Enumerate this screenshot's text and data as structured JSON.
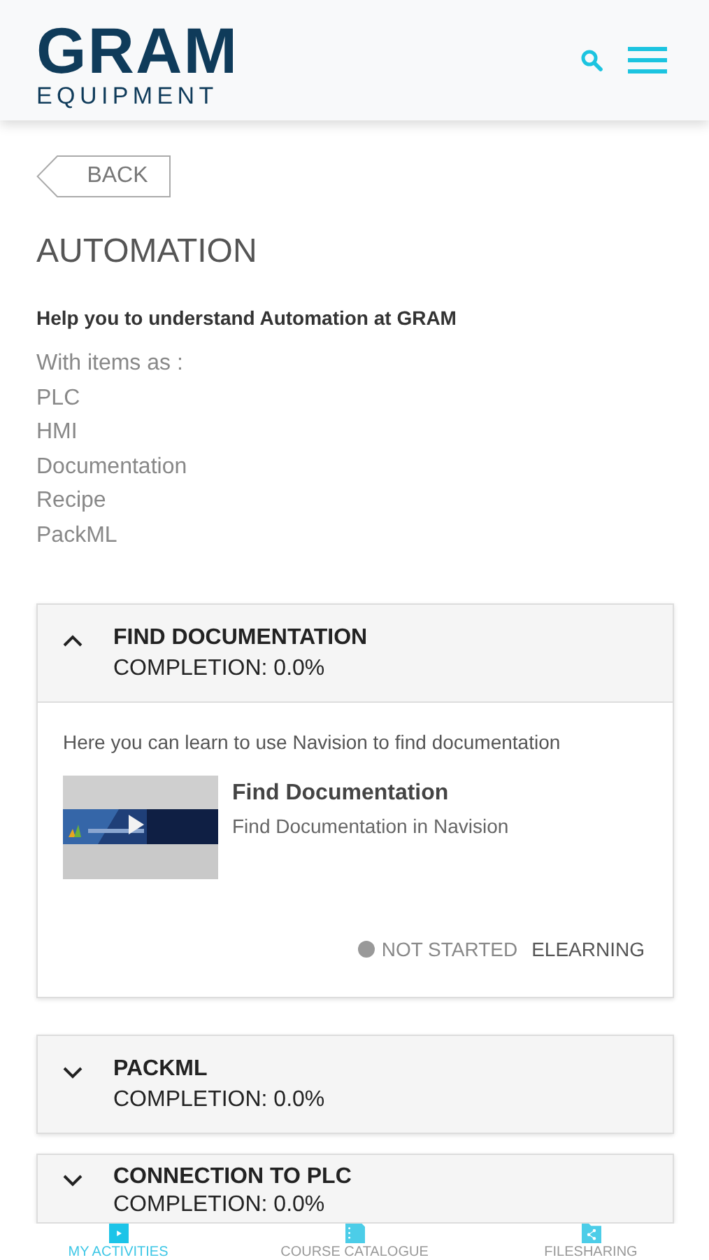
{
  "header": {
    "logo_main": "GRAM",
    "logo_sub": "EQUIPMENT"
  },
  "back_button": "BACK",
  "title": "AUTOMATION",
  "subtitle": "Help you to understand Automation at GRAM",
  "intro_lines": [
    "With items as :",
    "PLC",
    "HMI",
    "Documentation",
    "Recipe",
    "PackML"
  ],
  "sections": [
    {
      "title": "FIND DOCUMENTATION",
      "completion": "COMPLETION: 0.0%",
      "expanded": true,
      "description": "Here you can learn to use Navision to find documentation",
      "items": [
        {
          "kind": "picture",
          "title": "Find Documentation",
          "subtitle": "Find Documentation in Navision",
          "status": "NOT STARTED",
          "type": "ELEARNING"
        }
      ]
    },
    {
      "title": "PACKML",
      "completion": "COMPLETION: 0.0%",
      "expanded": false
    },
    {
      "title": "CONNECTION TO PLC",
      "completion": "COMPLETION: 0.0%",
      "expanded": false
    }
  ],
  "bottom_nav": [
    {
      "label": "MY ACTIVITIES",
      "selected": true,
      "kind": "play"
    },
    {
      "label": "COURSE CATALOGUE",
      "selected": false,
      "kind": "catalogue"
    },
    {
      "label": "FILESHARING",
      "selected": false,
      "kind": "share"
    }
  ]
}
